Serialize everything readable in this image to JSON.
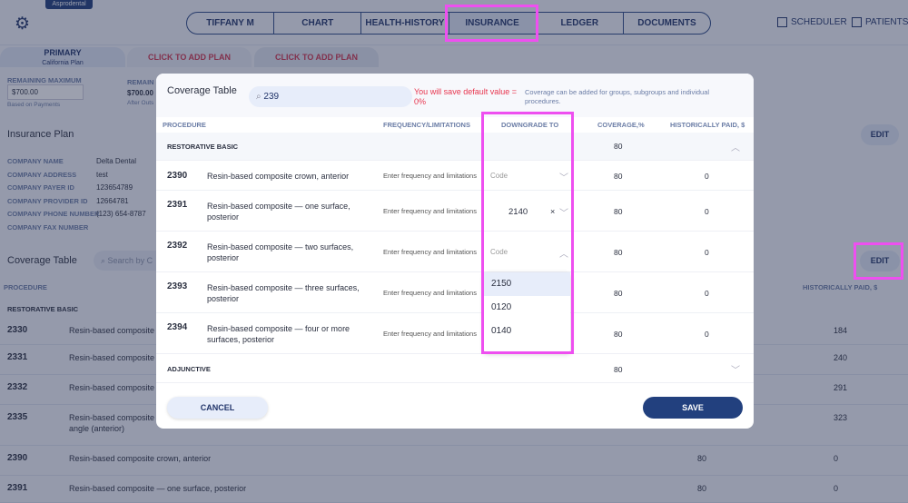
{
  "app": {
    "logo": "Asprodental",
    "icon": "gear-icon"
  },
  "nav": {
    "tabs": [
      "TIFFANY M NGUYEN",
      "CHART",
      "HEALTH-HISTORY",
      "INSURANCE",
      "LEDGER",
      "DOCUMENTS"
    ],
    "active": "INSURANCE",
    "scheduler": "SCHEDULER",
    "patients": "PATIENTS"
  },
  "plans": {
    "primary": "PRIMARY",
    "primary_sub": "California Plan",
    "add1": "CLICK TO ADD PLAN",
    "add2": "CLICK TO ADD PLAN"
  },
  "remaining": {
    "label": "REMAINING MAXIMUM",
    "value": "$700.00",
    "note": "Based on Payments",
    "label2": "REMAIN",
    "value2": "$700.00",
    "note2": "After Outs"
  },
  "insurance_plan": {
    "title": "Insurance Plan",
    "edit": "EDIT",
    "fields": [
      {
        "label": "COMPANY NAME",
        "value": "Delta Dental"
      },
      {
        "label": "COMPANY ADDRESS",
        "value": "test"
      },
      {
        "label": "COMPANY PAYER ID",
        "value": "123654789"
      },
      {
        "label": "COMPANY PROVIDER ID",
        "value": "12664781"
      },
      {
        "label": "COMPANY PHONE NUMBER",
        "value": "(123) 654-8787"
      },
      {
        "label": "COMPANY FAX NUMBER",
        "value": ""
      }
    ]
  },
  "bg_table": {
    "title": "Coverage Table",
    "search_placeholder": "Search by C",
    "edit": "EDIT",
    "col_procedure": "PROCEDURE",
    "col_hist": "HISTORICALLY PAID, $",
    "group": "RESTORATIVE BASIC",
    "rows": [
      {
        "code": "2330",
        "desc": "Resin-based composite",
        "cov": "",
        "hist": "184"
      },
      {
        "code": "2331",
        "desc": "Resin-based composite",
        "cov": "",
        "hist": "240"
      },
      {
        "code": "2332",
        "desc": "Resin-based composite",
        "cov": "",
        "hist": "291"
      },
      {
        "code": "2335",
        "desc": "Resin-based composite",
        "desc2": "angle (anterior)",
        "cov": "",
        "hist": "323"
      },
      {
        "code": "2390",
        "desc": "Resin-based composite crown, anterior",
        "cov": "80",
        "hist": "0"
      },
      {
        "code": "2391",
        "desc": "Resin-based composite — one surface, posterior",
        "cov": "80",
        "hist": "0"
      }
    ]
  },
  "modal": {
    "title": "Coverage Table",
    "search_value": "239",
    "warning": "You will save default value = 0%",
    "info": "Coverage can be added for groups, subgroups and individual procedures.",
    "cols": [
      "PROCEDURE",
      "FREQUENCY/LIMITATIONS",
      "DOWNGRADE TO",
      "COVERAGE,%",
      "HISTORICALLY PAID, $"
    ],
    "group": {
      "name": "RESTORATIVE BASIC",
      "cov": "80"
    },
    "rows": [
      {
        "code": "2390",
        "desc": "Resin-based composite crown, anterior",
        "freq": "Enter frequency and limitations",
        "downgrade": "Code",
        "cov": "80",
        "hist": "0"
      },
      {
        "code": "2391",
        "desc": "Resin-based composite — one surface, posterior",
        "freq": "Enter frequency and limitations",
        "downgrade": "2140",
        "cov": "80",
        "hist": "0"
      },
      {
        "code": "2392",
        "desc": "Resin-based composite — two surfaces, posterior",
        "freq": "Enter frequency and limitations",
        "downgrade": "Code",
        "cov": "80",
        "hist": "0"
      },
      {
        "code": "2393",
        "desc": "Resin-based composite — three surfaces, posterior",
        "freq": "Enter frequency and limitations",
        "downgrade": "",
        "cov": "80",
        "hist": "0"
      },
      {
        "code": "2394",
        "desc": "Resin-based composite — four or more surfaces, posterior",
        "freq": "Enter frequency and limitations",
        "downgrade": "",
        "cov": "80",
        "hist": "0"
      }
    ],
    "group2": {
      "name": "ADJUNCTIVE",
      "cov": "80"
    },
    "dropdown_options": [
      "2150",
      "0120",
      "0140"
    ],
    "cancel": "CANCEL",
    "save": "SAVE"
  },
  "colors": {
    "accent": "#22356a",
    "highlight": "#ee4ff0",
    "warning": "#e8364f"
  }
}
